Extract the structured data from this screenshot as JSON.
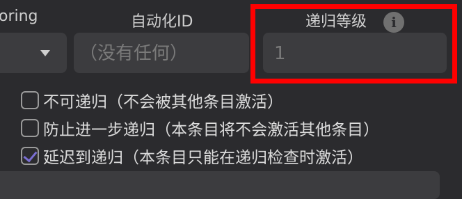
{
  "fields": {
    "string_label_fragment": "oring",
    "automation_id_label": "自动化ID",
    "automation_id_placeholder": "（没有任何）",
    "recursion_level_label": "递归等级",
    "recursion_level_value": "1",
    "info_glyph": "i"
  },
  "options": [
    {
      "label": "不可递归（不会被其他条目激活）",
      "checked": false
    },
    {
      "label": "防止进一步递归（本条目将不会激活其他条目）",
      "checked": false
    },
    {
      "label": "延迟到递归（本条目只能在递归检查时激活）",
      "checked": true
    }
  ],
  "colors": {
    "highlight": "#ff0000",
    "checkmark": "#7b6fd4",
    "background": "#2b2b2e",
    "field_background": "#3c3c3f"
  }
}
